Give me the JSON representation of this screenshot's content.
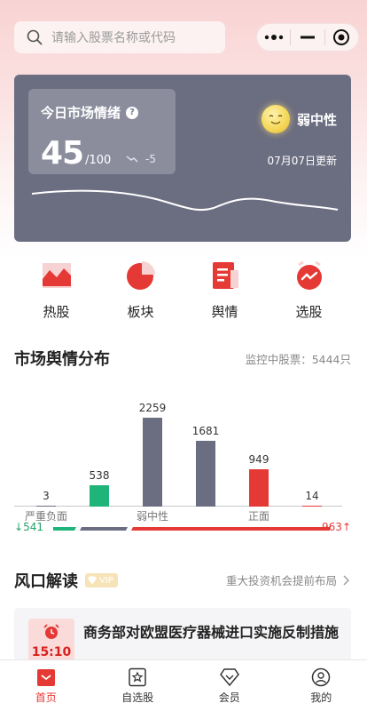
{
  "search": {
    "placeholder": "请输入股票名称或代码"
  },
  "capsule": {
    "more_icon": "more-dots-icon",
    "minimize_icon": "minus-icon",
    "close_icon": "target-icon"
  },
  "sentiment": {
    "title": "今日市场情绪",
    "score": "45",
    "score_max": "/100",
    "delta": "-5",
    "mood": "弱中性",
    "updated": "07月07日更新",
    "colors": {
      "card": "#6b6d80",
      "box": "#8b8d9d"
    }
  },
  "quick": [
    {
      "label": "热股",
      "icon": "trend-chart-icon"
    },
    {
      "label": "板块",
      "icon": "pie-chart-icon"
    },
    {
      "label": "舆情",
      "icon": "document-icon"
    },
    {
      "label": "选股",
      "icon": "alarm-trend-icon"
    }
  ],
  "distribution": {
    "title": "市场舆情分布",
    "monitor": "监控中股票：5444只",
    "left_count": "541",
    "right_count": "963",
    "ratio_down_arrow": "↓",
    "ratio_up_arrow": "↑"
  },
  "chart_data": {
    "type": "bar",
    "categories": [
      "严重负面",
      "",
      "弱中性",
      "",
      "正面",
      ""
    ],
    "values": [
      3,
      538,
      2259,
      1681,
      949,
      14
    ],
    "value_labels": [
      "3",
      "538",
      "2259",
      "1681",
      "949",
      "14"
    ],
    "colors": [
      "#6b6d80",
      "#1fb47a",
      "#6b6d80",
      "#6b6d80",
      "#e53935",
      "#e53935"
    ],
    "ylim": [
      0,
      2259
    ]
  },
  "wind": {
    "title": "风口解读",
    "vip_label": "VIP",
    "right_text": "重大投资机会提前布局",
    "news_time": "15:10",
    "news_title": "商务部对欧盟医疗器械进口实施反制措施"
  },
  "tabbar": [
    {
      "label": "首页",
      "icon": "home-icon",
      "active": true
    },
    {
      "label": "自选股",
      "icon": "star-bookmark-icon",
      "active": false
    },
    {
      "label": "会员",
      "icon": "diamond-icon",
      "active": false
    },
    {
      "label": "我的",
      "icon": "user-icon",
      "active": false
    }
  ]
}
